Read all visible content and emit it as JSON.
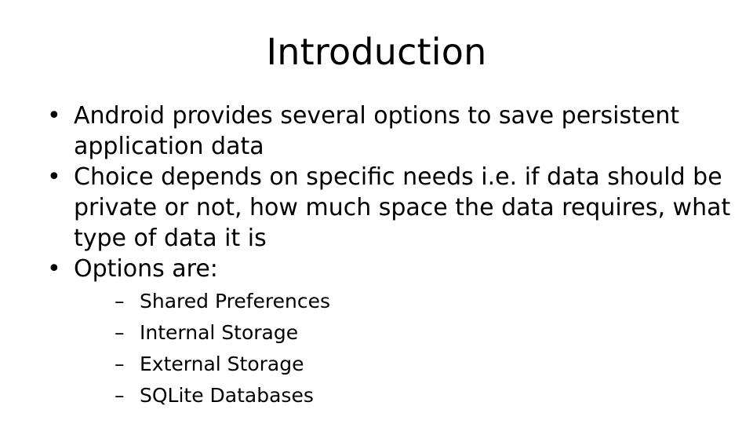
{
  "slide": {
    "title": "Introduction",
    "bullets": [
      {
        "marker": "•",
        "text": "Android provides several options to save persistent application data"
      },
      {
        "marker": "•",
        "text": "Choice depends on specific needs i.e. if data should be private or not, how much space the data requires, what type of data it is"
      },
      {
        "marker": "•",
        "text": "Options are:"
      }
    ],
    "sub_bullets": [
      {
        "marker": "–",
        "text": "Shared Preferences"
      },
      {
        "marker": "–",
        "text": "Internal Storage"
      },
      {
        "marker": "–",
        "text": "External Storage"
      },
      {
        "marker": "–",
        "text": "SQLite Databases"
      }
    ],
    "colors": {
      "background": "#ffffff",
      "text": "#000000"
    }
  }
}
